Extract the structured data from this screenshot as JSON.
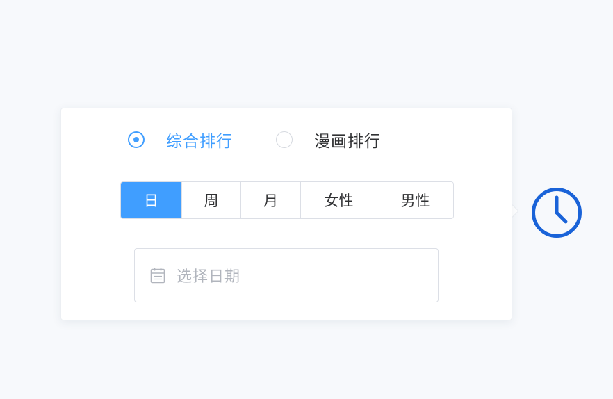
{
  "ranking_type": {
    "options": [
      {
        "label": "综合排行",
        "checked": true
      },
      {
        "label": "漫画排行",
        "checked": false
      }
    ]
  },
  "period_tabs": [
    {
      "label": "日",
      "active": true
    },
    {
      "label": "周",
      "active": false
    },
    {
      "label": "月",
      "active": false
    },
    {
      "label": "女性",
      "active": false
    },
    {
      "label": "男性",
      "active": false
    }
  ],
  "date_picker": {
    "placeholder": "选择日期",
    "icon": "calendar-icon"
  },
  "clock_button": {
    "icon": "clock-icon"
  },
  "colors": {
    "accent": "#409eff",
    "clock": "#1a63d8",
    "border": "#dcdfe6",
    "text": "#303133",
    "placeholder": "#b1b5bd"
  }
}
